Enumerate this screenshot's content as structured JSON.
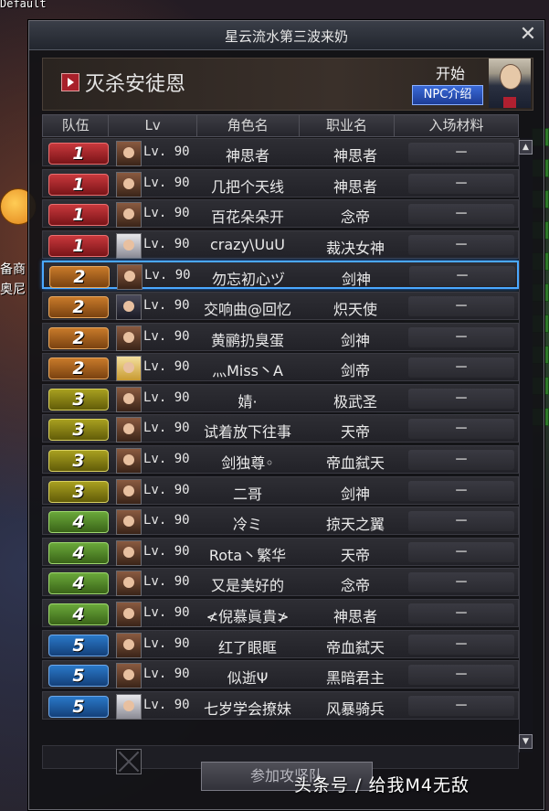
{
  "window": {
    "top_left_label": "Default",
    "title": "星云流水第三波来奶",
    "close_glyph": "✕"
  },
  "side": {
    "text_1": "备商",
    "text_2": "奥尼"
  },
  "header": {
    "target_name": "灭杀安徒恩",
    "start_label": "开始",
    "npc_button": "NPC介绍"
  },
  "columns": [
    "队伍",
    "Lv",
    "角色名",
    "职业名",
    "入场材料"
  ],
  "rows": [
    {
      "team": "1",
      "lv": "Lv. 90",
      "name": "神思者",
      "job": "神思者",
      "mat": "－",
      "avatar": "brown"
    },
    {
      "team": "1",
      "lv": "Lv. 90",
      "name": "几把个天线",
      "job": "神思者",
      "mat": "－",
      "avatar": "brown"
    },
    {
      "team": "1",
      "lv": "Lv. 90",
      "name": "百花朵朵开",
      "job": "念帝",
      "mat": "－",
      "avatar": "brown"
    },
    {
      "team": "1",
      "lv": "Lv. 90",
      "name": "crazy\\UuU",
      "job": "裁决女神",
      "mat": "－",
      "avatar": "white"
    },
    {
      "team": "2",
      "lv": "Lv. 90",
      "name": "勿忘初心ヅ",
      "job": "剑神",
      "mat": "－",
      "avatar": "brown"
    },
    {
      "team": "2",
      "lv": "Lv. 90",
      "name": "交响曲@回忆",
      "job": "炽天使",
      "mat": "－",
      "avatar": "dark"
    },
    {
      "team": "2",
      "lv": "Lv. 90",
      "name": "黄鹂扔臭蛋",
      "job": "剑神",
      "mat": "－",
      "avatar": "brown"
    },
    {
      "team": "2",
      "lv": "Lv. 90",
      "name": "灬Miss丶A",
      "job": "剑帝",
      "mat": "－",
      "avatar": "gold"
    },
    {
      "team": "3",
      "lv": "Lv. 90",
      "name": "婧·",
      "job": "极武圣",
      "mat": "－",
      "avatar": "brown"
    },
    {
      "team": "3",
      "lv": "Lv. 90",
      "name": "试着放下往事",
      "job": "天帝",
      "mat": "－",
      "avatar": "brown"
    },
    {
      "team": "3",
      "lv": "Lv. 90",
      "name": "剑独尊◦",
      "job": "帝血弑天",
      "mat": "－",
      "avatar": "brown"
    },
    {
      "team": "3",
      "lv": "Lv. 90",
      "name": "二哥",
      "job": "剑神",
      "mat": "－",
      "avatar": "brown"
    },
    {
      "team": "4",
      "lv": "Lv. 90",
      "name": "冷ミ",
      "job": "掠天之翼",
      "mat": "－",
      "avatar": "brown"
    },
    {
      "team": "4",
      "lv": "Lv. 90",
      "name": "Rota丶繁华",
      "job": "天帝",
      "mat": "－",
      "avatar": "brown"
    },
    {
      "team": "4",
      "lv": "Lv. 90",
      "name": "又是美好的",
      "job": "念帝",
      "mat": "－",
      "avatar": "brown"
    },
    {
      "team": "4",
      "lv": "Lv. 90",
      "name": "≮倪慕眞貴≯",
      "job": "神思者",
      "mat": "－",
      "avatar": "brown"
    },
    {
      "team": "5",
      "lv": "Lv. 90",
      "name": "红了眼眶",
      "job": "帝血弑天",
      "mat": "－",
      "avatar": "brown"
    },
    {
      "team": "5",
      "lv": "Lv. 90",
      "name": "似逝Ψ",
      "job": "黑暗君主",
      "mat": "－",
      "avatar": "brown"
    },
    {
      "team": "5",
      "lv": "Lv. 90",
      "name": "七岁学会撩妹",
      "job": "风暴骑兵",
      "mat": "－",
      "avatar": "white"
    }
  ],
  "selected_row_index": 4,
  "join_button": "参加攻坚队",
  "watermark": "头条号 / 给我M4无敌",
  "scroll": {
    "up": "▲",
    "down": "▼"
  }
}
